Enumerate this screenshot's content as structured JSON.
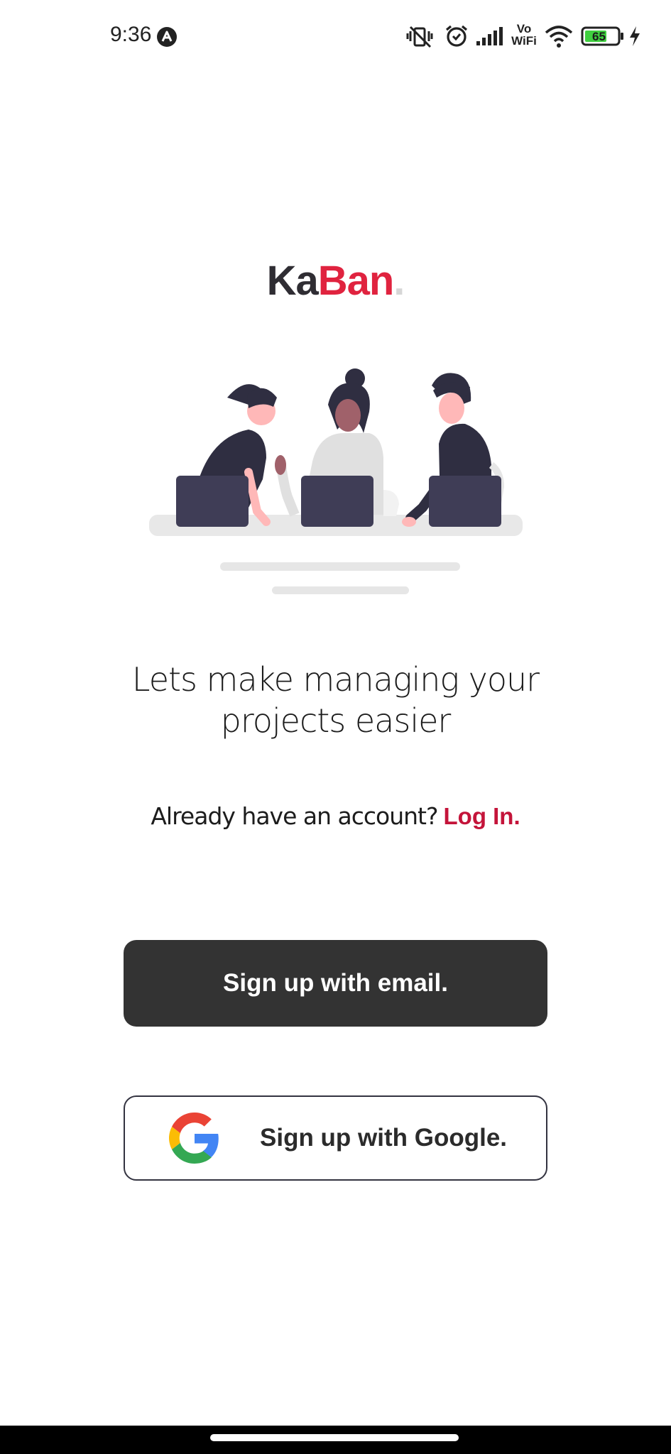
{
  "status_bar": {
    "time": "9:36",
    "battery_level": "65",
    "icons": [
      "app-notification-icon",
      "vibrate-off-icon",
      "alarm-icon",
      "cellular-signal-icon",
      "vowifi-icon",
      "wifi-icon",
      "battery-icon",
      "charging-icon"
    ],
    "vowifi_top": "Vo",
    "vowifi_bottom": "WiFi"
  },
  "logo": {
    "part1": "Ka",
    "part2": "Ban",
    "dot": "."
  },
  "illustration": {
    "subject": "three-people-at-laptops-illustration"
  },
  "tagline": {
    "line1": "Lets make managing your",
    "line2": "projects easier"
  },
  "account": {
    "prompt": "Already have an account?",
    "login_label": "Log In."
  },
  "buttons": {
    "email_label": "Sign up with email.",
    "google_label": "Sign up with Google."
  },
  "colors": {
    "brand_red": "#e0233f",
    "link_red": "#c4143a",
    "dark_button": "#333333",
    "text_dark": "#2f2d33"
  }
}
